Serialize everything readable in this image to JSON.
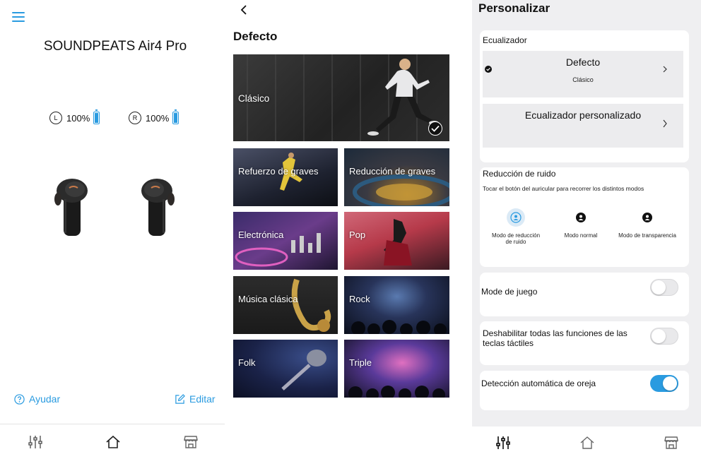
{
  "home": {
    "device_name": "SOUNDPEATS Air4 Pro",
    "left_label": "L",
    "left_battery": "100%",
    "right_label": "R",
    "right_battery": "100%",
    "help_label": "Ayudar",
    "edit_label": "Editar",
    "accent": "#2a9be0"
  },
  "nav": {
    "items": [
      {
        "icon": "equalizer-icon"
      },
      {
        "icon": "home-icon"
      },
      {
        "icon": "store-icon"
      }
    ]
  },
  "eq_presets": {
    "title": "Defecto",
    "selected": "Clásico",
    "tiles": [
      {
        "label": "Clásico",
        "selected": true
      },
      {
        "label": "Refuerzo de graves"
      },
      {
        "label": "Reducción de graves"
      },
      {
        "label": "Electrónica"
      },
      {
        "label": "Pop"
      },
      {
        "label": "Música clásica"
      },
      {
        "label": "Rock"
      },
      {
        "label": "Folk"
      },
      {
        "label": "Triple"
      }
    ]
  },
  "customize": {
    "title": "Personalizar",
    "equalizer_label": "Ecualizador",
    "eq_default_title": "Defecto",
    "eq_default_sub": "Clásico",
    "eq_custom_title": "Ecualizador personalizado",
    "noise_title": "Reducción de ruido",
    "noise_hint": "Tocar el botón del auricular para recorrer los distintos modos",
    "modes": [
      {
        "line1": "Modo de reducción",
        "line2": "de ruido",
        "active": true
      },
      {
        "line1": "Modo normal",
        "line2": "",
        "active": false
      },
      {
        "line1": "Modo de transparencia",
        "line2": "",
        "active": false
      }
    ],
    "game_mode_label": "Mode de juego",
    "game_mode_on": false,
    "disable_touch_line1": "Deshabilitar todas las funciones de las",
    "disable_touch_line2": "teclas táctiles",
    "disable_touch_on": false,
    "ear_detect_label": "Detección automática de oreja",
    "ear_detect_on": true
  }
}
